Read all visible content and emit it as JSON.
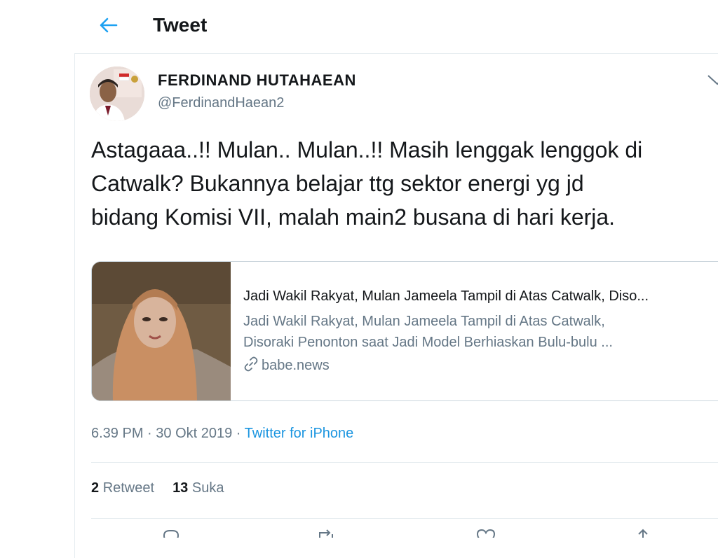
{
  "header": {
    "title": "Tweet",
    "back_icon": "arrow-left-icon"
  },
  "tweet": {
    "author": {
      "name": "FERDINAND HUTAHAEAN",
      "handle": "@FerdinandHaean2"
    },
    "text_lines": [
      "Astagaaa..!! Mulan.. Mulan..!! Masih lenggak lenggok di",
      "Catwalk? Bukannya belajar ttg sektor energi yg jd",
      "bidang Komisi VII, malah main2 busana di hari kerja."
    ],
    "link_card": {
      "title": "Jadi Wakil Rakyat, Mulan Jameela Tampil di Atas Catwalk, Diso...",
      "description_lines": [
        "Jadi Wakil Rakyat, Mulan Jameela Tampil di Atas Catwalk,",
        "Disoraki Penonton saat Jadi Model Berhiaskan Bulu-bulu ..."
      ],
      "domain": "babe.news",
      "domain_icon": "link-icon"
    },
    "time": "6.39 PM",
    "separator": " · ",
    "date": "30 Okt 2019",
    "source": "Twitter for iPhone",
    "retweets": {
      "count": "2",
      "label": "Retweet"
    },
    "likes": {
      "count": "13",
      "label": "Suka"
    }
  },
  "colors": {
    "accent": "#1da1f2",
    "text": "#14171a",
    "secondary_text": "#657786",
    "border": "#e6ecf0"
  }
}
